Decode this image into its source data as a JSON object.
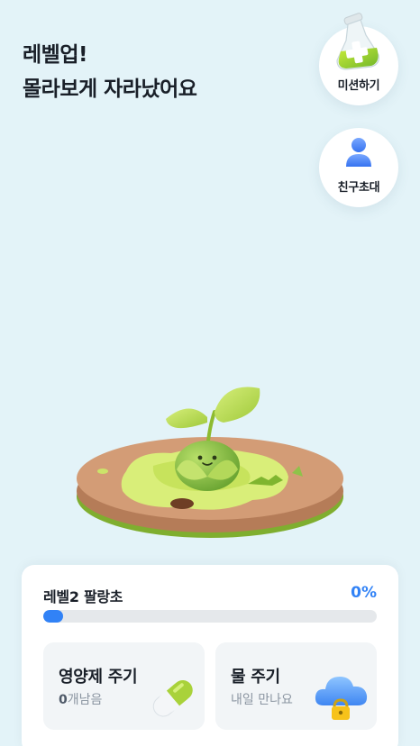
{
  "headline": {
    "line1": "레벨업!",
    "line2": "몰라보게 자라났어요"
  },
  "side_buttons": {
    "mission_label": "미션하기",
    "invite_label": "친구초대"
  },
  "status_card": {
    "level_name": "레벨2 팔랑초",
    "progress_text": "0%",
    "progress_value": 0
  },
  "actions": {
    "nutrient": {
      "title": "영양제 주기",
      "count": "0",
      "count_suffix": "개남음",
      "icon": "pill-icon"
    },
    "water": {
      "title": "물 주기",
      "subtitle": "내일 만나요",
      "icon": "locked-cloud-icon"
    }
  },
  "colors": {
    "background": "#e3f3f8",
    "accent": "#3182f6",
    "plant_green": "#a6cf3c",
    "soil": "#c9906a"
  }
}
